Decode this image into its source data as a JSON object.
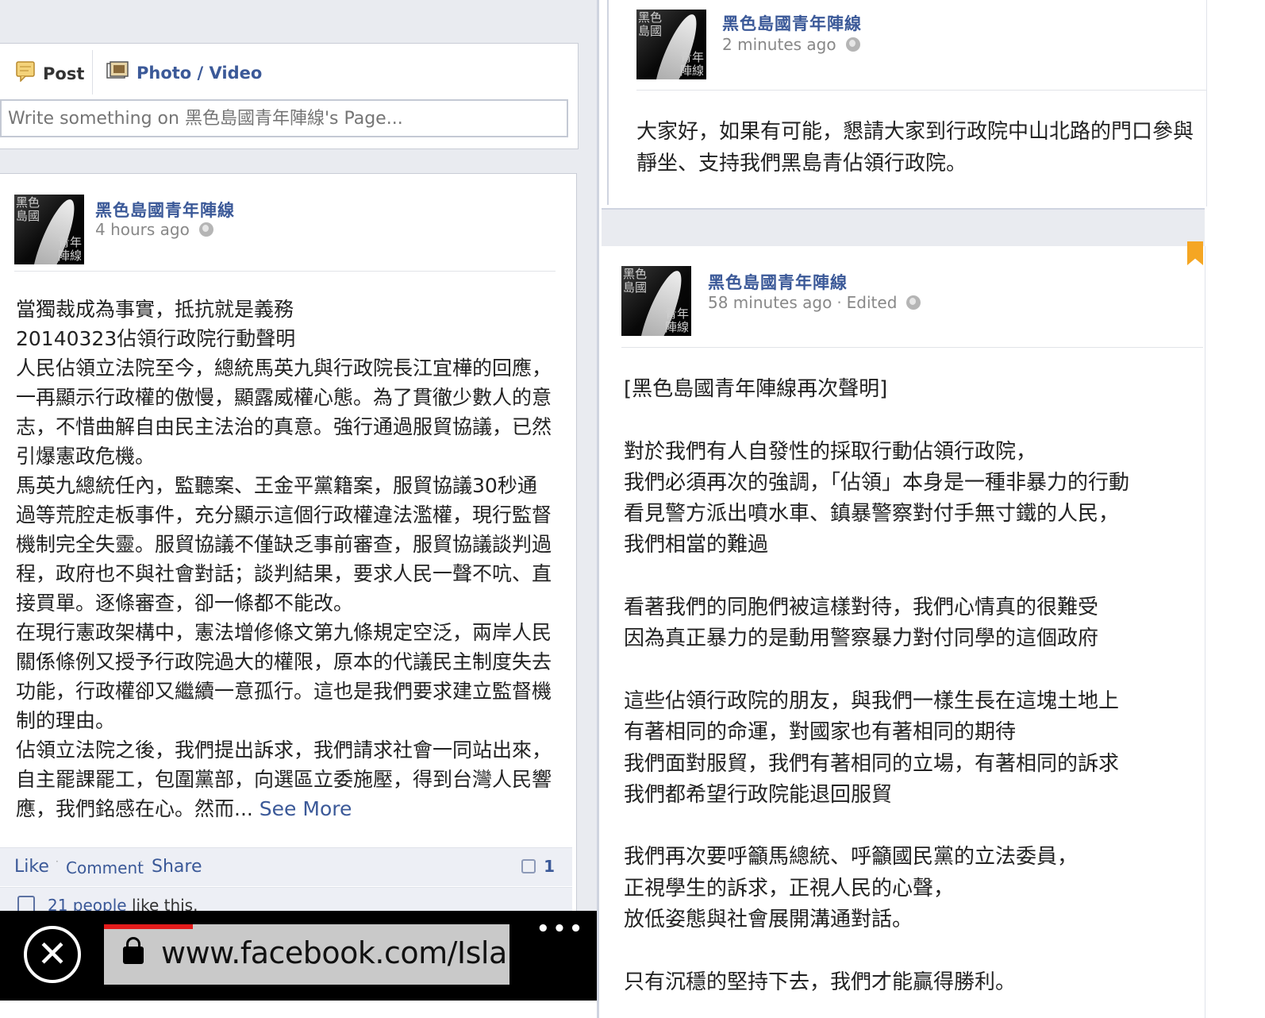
{
  "composer": {
    "post_tab": "Post",
    "photo_tab": "Photo / Video",
    "placeholder": "Write something on 黑色島國青年陣線's Page..."
  },
  "avatar": {
    "line1": "黑色島國",
    "line2": "青年陣線"
  },
  "post1": {
    "author": "黑色島國青年陣線",
    "time": "4 hours ago",
    "text": "當獨裁成為事實，抵抗就是義務\n20140323佔領行政院行動聲明\n人民佔領立法院至今，總統馬英九與行政院長江宜樺的回應，一再顯示行政權的傲慢，顯露威權心態。為了貫徹少數人的意志，不惜曲解自由民主法治的真意。強行通過服貿協議，已然引爆憲政危機。\n馬英九總統任內，監聽案、王金平黨籍案，服貿協議30秒通過等荒腔走板事件，充分顯示這個行政權違法濫權，現行監督機制完全失靈。服貿協議不僅缺乏事前審查，服貿協議談判過程，政府也不與社會對話；談判結果，要求人民一聲不吭、直接買單。逐條審查，卻一條都不能改。\n在現行憲政架構中，憲法增修條文第九條規定空泛，兩岸人民關係條例又授予行政院過大的權限，原本的代議民主制度失去功能，行政權卻又繼續一意孤行。這也是我們要求建立監督機制的理由。\n佔領立法院之後，我們提出訴求，我們請求社會一同站出來，自主罷課罷工，包圍黨部，向選區立委施壓，得到台灣人民響應，我們銘感在心。然而...",
    "see_more": "See More",
    "actions": {
      "like": "Like",
      "comment": "Comment",
      "share": "Share",
      "comment_count": "1"
    },
    "likes": {
      "people": "21 people",
      "suffix": " like this."
    }
  },
  "post2": {
    "author": "黑色島國青年陣線",
    "time": "2 minutes ago",
    "text": "大家好，如果有可能，懇請大家到行政院中山北路的門口參與靜坐、支持我們黑島青佔領行政院。"
  },
  "post3": {
    "author": "黑色島國青年陣線",
    "time": "58 minutes ago",
    "edited": "Edited",
    "text": "[黑色島國青年陣線再次聲明]\n\n對於我們有人自發性的採取行動佔領行政院，\n我們必須再次的強調，「佔領」本身是一種非暴力的行動\n看見警方派出噴水車、鎮暴警察對付手無寸鐵的人民，\n我們相當的難過\n\n看著我們的同胞們被這樣對待，我們心情真的很難受\n因為真正暴力的是動用警察暴力對付同學的這個政府\n\n這些佔領行政院的朋友，與我們一樣生長在這塊土地上\n有著相同的命運，對國家也有著相同的期待\n我們面對服貿，我們有著相同的立場，有著相同的訴求\n我們都希望行政院能退回服貿\n\n我們再次要呼籲馬總統、呼籲國民黨的立法委員，\n正視學生的訴求，正視人民的心聲，\n放低姿態與社會展開溝通對話。\n\n只有沉穩的堅持下去，我們才能贏得勝利。"
  },
  "browser": {
    "close_glyph": "✕",
    "url": "www.facebook.com/Island",
    "progress": 0.22,
    "more_glyph": "•••"
  },
  "icons": {
    "post": "post-icon",
    "photo": "photo-icon",
    "globe": "globe-icon",
    "comment": "comment-icon",
    "like": "thumbs-up-icon",
    "lock": "lock-icon",
    "bookmark": "bookmark-icon"
  },
  "colors": {
    "link": "#3b5998",
    "progress": "#e31b1b",
    "bookmark": "#f5a623"
  }
}
